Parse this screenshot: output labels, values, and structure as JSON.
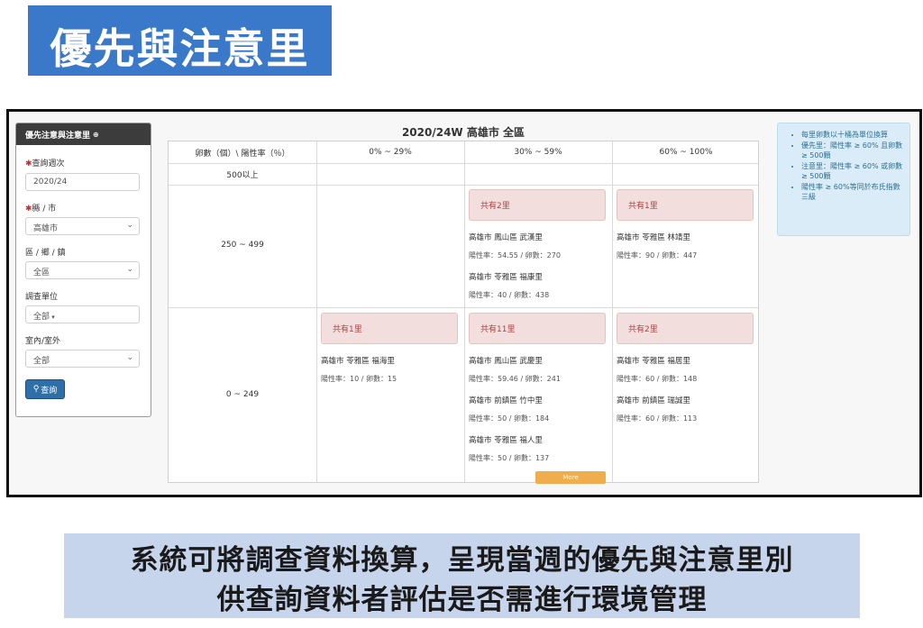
{
  "slide_title": "優先與注意里",
  "filter": {
    "header": "優先注意與注意里",
    "header_icon": "plus-circle-icon",
    "week_label": "查詢週次",
    "week_value": "2020/24",
    "county_label": "縣 / 市",
    "county_value": "高雄市",
    "district_label": "區 / 鄉 / 鎮",
    "district_value": "全區",
    "unit_label": "調查單位",
    "unit_value": "全部",
    "place_label": "室內/室外",
    "place_value": "全部",
    "query_button": "查詢",
    "required_mark": "✱"
  },
  "matrix": {
    "title": "2020/24W 高雄市 全區",
    "corner_header": "卵數（個）\\ 陽性率（％）",
    "col_headers": [
      "0% ~ 29%",
      "30% ~ 59%",
      "60% ~ 100%"
    ],
    "row_labels": [
      "500以上",
      "250 ~ 499",
      "0 ~ 249"
    ],
    "cells": {
      "r2c2": {
        "count": "共有2里",
        "items": [
          {
            "name": "高雄市 鳳山區 武漢里",
            "stat": "陽性率：54.55 / 卵數：270"
          },
          {
            "name": "高雄市 苓雅區 福康里",
            "stat": "陽性率：40 / 卵數：438"
          }
        ]
      },
      "r2c3": {
        "count": "共有1里",
        "items": [
          {
            "name": "高雄市 苓雅區 林靖里",
            "stat": "陽性率：90 / 卵數：447"
          }
        ]
      },
      "r3c1": {
        "count": "共有1里",
        "items": [
          {
            "name": "高雄市 苓雅區 福海里",
            "stat": "陽性率：10 / 卵數：15"
          }
        ]
      },
      "r3c2": {
        "count": "共有11里",
        "items": [
          {
            "name": "高雄市 鳳山區 武慶里",
            "stat": "陽性率：59.46 / 卵數：241"
          },
          {
            "name": "高雄市 前鎮區 竹中里",
            "stat": "陽性率：50 / 卵數：184"
          },
          {
            "name": "高雄市 苓雅區 福人里",
            "stat": "陽性率：50 / 卵數：137"
          }
        ],
        "more": "More"
      },
      "r3c3": {
        "count": "共有2里",
        "items": [
          {
            "name": "高雄市 苓雅區 福居里",
            "stat": "陽性率：60 / 卵數：148"
          },
          {
            "name": "高雄市 前鎮區 瑞誠里",
            "stat": "陽性率：60 / 卵數：113"
          }
        ]
      }
    }
  },
  "notes": [
    "每里卵數以十桶為單位換算",
    "優先里：陽性率 ≥ 60% 且卵數 ≥ 500顆",
    "注意里：陽性率 ≥ 60% 或卵數 ≥ 500顆",
    "陽性率 ≥ 60%等同於布氏指數三級"
  ],
  "caption": {
    "line1": "系統可將調查資料換算，呈現當週的優先與注意里別",
    "line2": "供查詢資料者評估是否需進行環境管理"
  },
  "colors": {
    "banner": "#3a78c9",
    "warning_box": "#f3dede",
    "more_button": "#f0ad4e",
    "query_button": "#2f6fa8",
    "note_panel": "#d9ecf7"
  }
}
